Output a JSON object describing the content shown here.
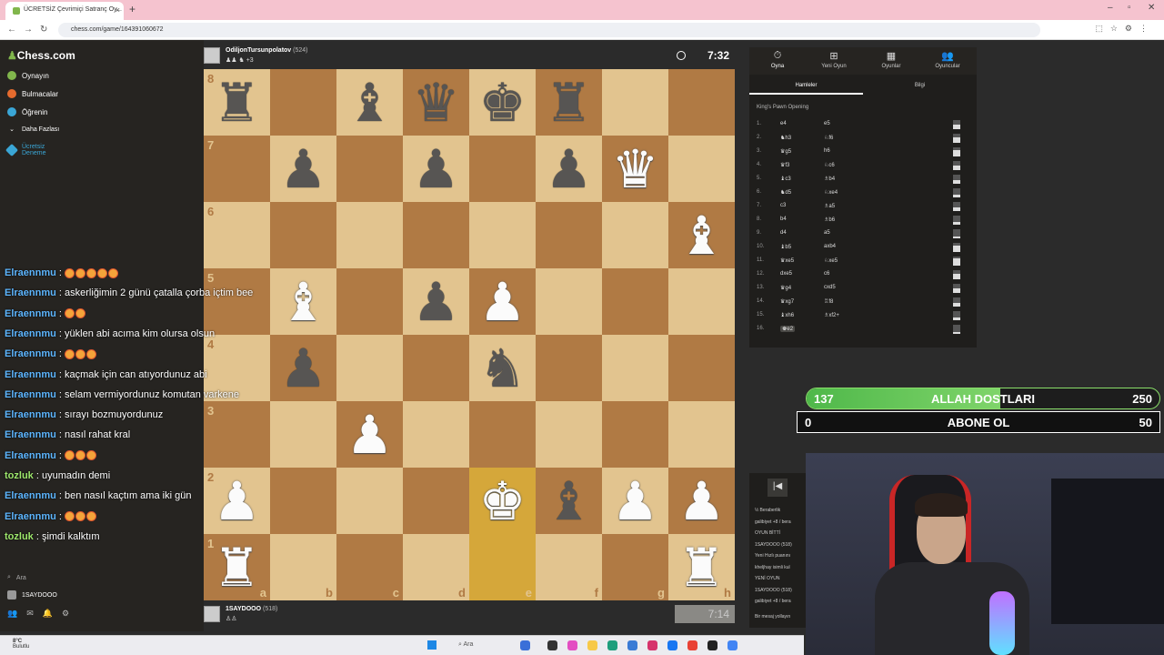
{
  "browser": {
    "tab_title": "ÜCRETSİZ Çevrimiçi Satranç Oy...",
    "url": "chess.com/game/164391060672"
  },
  "sidebar": {
    "logo": "Chess.com",
    "items": [
      {
        "label": "Oynayın",
        "color": "#81b64c"
      },
      {
        "label": "Bulmacalar",
        "color": "#e66b2e"
      },
      {
        "label": "Öğrenin",
        "color": "#3aa6d6"
      },
      {
        "label": "Daha Fazlası",
        "color": "#888888"
      },
      {
        "label": "Ücretsiz\nDeneme",
        "color": "#3aa6d6"
      }
    ],
    "search": "Ara",
    "username": "1SAYDOOO"
  },
  "chat": [
    {
      "user": "Elraennmu",
      "text": "",
      "emotes": 5,
      "alt": false
    },
    {
      "user": "Elraennmu",
      "text": "askerliğimin 2 günü çatalla çorba içtim bee",
      "emotes": 0,
      "alt": false
    },
    {
      "user": "Elraennmu",
      "text": "",
      "emotes": 2,
      "alt": false
    },
    {
      "user": "Elraennmu",
      "text": "yüklen abi acıma kim olursa olsun",
      "emotes": 0,
      "alt": false
    },
    {
      "user": "Elraennmu",
      "text": "",
      "emotes": 3,
      "alt": false
    },
    {
      "user": "Elraennmu",
      "text": "kaçmak için can atıyordunuz abi",
      "emotes": 0,
      "alt": false
    },
    {
      "user": "Elraennmu",
      "text": "selam vermiyordunuz komutan varkene",
      "emotes": 0,
      "alt": false
    },
    {
      "user": "Elraennmu",
      "text": "sırayı bozmuyordunuz",
      "emotes": 0,
      "alt": false
    },
    {
      "user": "Elraennmu",
      "text": "nasıl rahat kral",
      "emotes": 0,
      "alt": false
    },
    {
      "user": "Elraennmu",
      "text": "",
      "emotes": 3,
      "alt": false
    },
    {
      "user": "tozluk",
      "text": "uyumadın demi",
      "emotes": 0,
      "alt": true
    },
    {
      "user": "Elraennmu",
      "text": "ben nasıl kaçtım ama iki gün",
      "emotes": 0,
      "alt": false
    },
    {
      "user": "Elraennmu",
      "text": "",
      "emotes": 3,
      "alt": false
    },
    {
      "user": "tozluk",
      "text": "şimdi kalktım",
      "emotes": 0,
      "alt": true
    }
  ],
  "top_player": {
    "name": "OdiljonTursunpolatov",
    "rating": "(524)",
    "extra": "+3",
    "clock": "7:32"
  },
  "bottom_player": {
    "name": "1SAYDOOO",
    "rating": "(518)",
    "clock": "7:14"
  },
  "board": {
    "ranks": [
      "8",
      "7",
      "6",
      "5",
      "4",
      "3",
      "2",
      "1"
    ],
    "files": [
      "a",
      "b",
      "c",
      "d",
      "e",
      "f",
      "g",
      "h"
    ],
    "position": [
      [
        "bR",
        "",
        "bB",
        "bQ",
        "bK",
        "bR",
        "",
        ""
      ],
      [
        "",
        "bP",
        "",
        "bP",
        "",
        "bP",
        "wQ",
        ""
      ],
      [
        "",
        "",
        "",
        "",
        "",
        "",
        "",
        "wB"
      ],
      [
        "",
        "wB",
        "",
        "bP",
        "wP",
        "",
        "",
        ""
      ],
      [
        "",
        "bP",
        "",
        "",
        "bN",
        "",
        "",
        ""
      ],
      [
        "",
        "",
        "wP",
        "",
        "",
        "",
        "",
        ""
      ],
      [
        "wP",
        "",
        "",
        "",
        "wK",
        "bB",
        "wP",
        "wP"
      ],
      [
        "wR",
        "",
        "",
        "",
        "",
        "",
        "",
        "wR"
      ]
    ],
    "highlight": [
      "e2",
      "e1"
    ]
  },
  "right_panel": {
    "tabs": [
      {
        "label": "Oyna",
        "icon": "⏱"
      },
      {
        "label": "Yeni Oyun",
        "icon": "⊞"
      },
      {
        "label": "Oyunlar",
        "icon": "▦"
      },
      {
        "label": "Oyuncular",
        "icon": "👥"
      }
    ],
    "subtabs": [
      "Hamleler",
      "Bilgi"
    ],
    "opening": "King's Pawn Opening",
    "moves": [
      {
        "n": "1.",
        "w": "e4",
        "b": "e5",
        "eval": 0.5
      },
      {
        "n": "2.",
        "w": "♞h3",
        "b": "♘f6",
        "eval": 0.6
      },
      {
        "n": "3.",
        "w": "♛g5",
        "b": "h6",
        "eval": 0.7
      },
      {
        "n": "4.",
        "w": "♛f3",
        "b": "♘c6",
        "eval": 0.5
      },
      {
        "n": "5.",
        "w": "♝c3",
        "b": "♗b4",
        "eval": 0.4
      },
      {
        "n": "6.",
        "w": "♞d5",
        "b": "♘xe4",
        "eval": 0.3
      },
      {
        "n": "7.",
        "w": "c3",
        "b": "♗a5",
        "eval": 0.4
      },
      {
        "n": "8.",
        "w": "b4",
        "b": "♗b6",
        "eval": 0.3
      },
      {
        "n": "9.",
        "w": "d4",
        "b": "a5",
        "eval": 0.2
      },
      {
        "n": "10.",
        "w": "♝b5",
        "b": "axb4",
        "eval": 0.7
      },
      {
        "n": "11.",
        "w": "♛xe5",
        "b": "♘xe5",
        "eval": 0.8
      },
      {
        "n": "12.",
        "w": "dxe5",
        "b": "c6",
        "eval": 0.6
      },
      {
        "n": "13.",
        "w": "♛g4",
        "b": "cxd5",
        "eval": 0.5
      },
      {
        "n": "14.",
        "w": "♛xg7",
        "b": "♖f8",
        "eval": 0.4
      },
      {
        "n": "15.",
        "w": "♝xh6",
        "b": "♗xf2+",
        "eval": 0.3
      },
      {
        "n": "16.",
        "w": "♚e2",
        "b": "",
        "eval": 0.2
      }
    ]
  },
  "goals": [
    {
      "left": "137",
      "label": "ALLAH DOSTLARI",
      "right": "250",
      "progress": 0.548
    },
    {
      "left": "0",
      "label": "ABONE OL",
      "right": "50",
      "progress": 0
    }
  ],
  "right_chat": {
    "lines": [
      "½ Beraberlik",
      "galibiyet +8 / bera",
      "OYUN BİTTİ",
      "1SAYDOOO (518)",
      "Yeni Hızlı puanını",
      "kheljhay isimli kul",
      "YENİ OYUN",
      "1SAYDOOO (518)",
      "galibiyet +8 / bera",
      "Bir mesaj yollayın"
    ]
  },
  "taskbar": {
    "weather_temp": "8°C",
    "weather_text": "Bulutlu",
    "search": "Ara"
  }
}
